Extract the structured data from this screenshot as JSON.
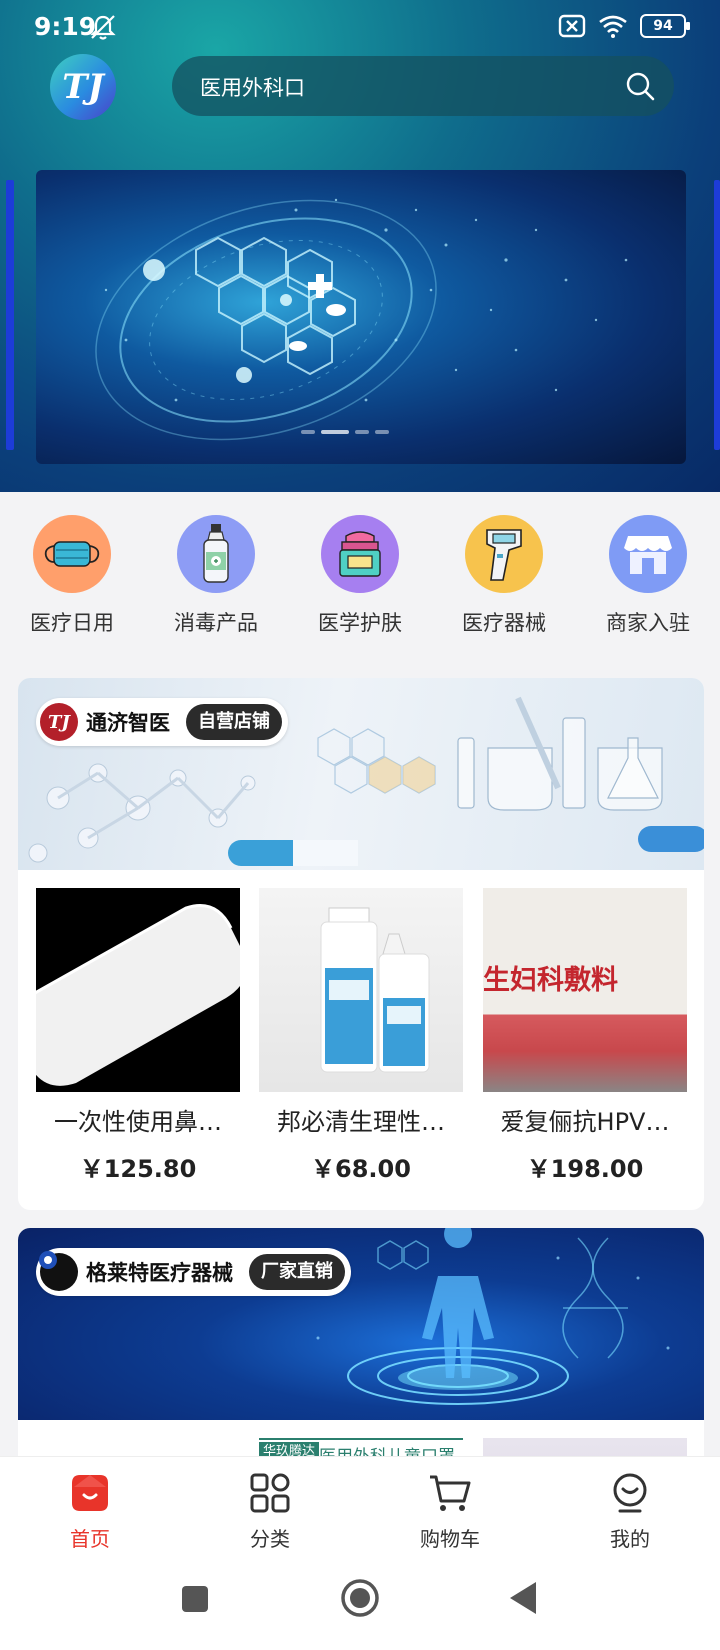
{
  "status_bar": {
    "time": "9:19",
    "battery": "94"
  },
  "search": {
    "value": "医用外科口"
  },
  "categories": [
    {
      "label": "医疗日用",
      "icon": "mask-icon",
      "color": "#ff9f6b"
    },
    {
      "label": "消毒产品",
      "icon": "disinfectant-bottle-icon",
      "color": "#8d9cf5"
    },
    {
      "label": "医学护肤",
      "icon": "skincare-jar-icon",
      "color": "#a67ff0"
    },
    {
      "label": "医疗器械",
      "icon": "thermometer-gun-icon",
      "color": "#f7c34d"
    },
    {
      "label": "商家入驻",
      "icon": "storefront-icon",
      "color": "#7f9bf5"
    }
  ],
  "stores": [
    {
      "name": "通济智医",
      "badge": "自营店铺",
      "logo_text": "TJ",
      "products": [
        {
          "name": "一次性使用鼻…",
          "price": "￥125.80"
        },
        {
          "name": "邦必清生理性…",
          "price": "￥68.00"
        },
        {
          "name": "爱复俪抗HPV…",
          "price": "￥198.00",
          "image_text": "生妇科敷料"
        }
      ]
    },
    {
      "name": "格莱特医疗器械",
      "badge": "厂家直销",
      "products_partial": [
        {
          "image_text_1": "华玖腾达",
          "image_text_2": "医用外科儿童口罩"
        }
      ]
    }
  ],
  "tabs": [
    {
      "label": "首页",
      "icon": "home-icon",
      "active": true
    },
    {
      "label": "分类",
      "icon": "category-grid-icon",
      "active": false
    },
    {
      "label": "购物车",
      "icon": "cart-icon",
      "active": false
    },
    {
      "label": "我的",
      "icon": "profile-icon",
      "active": false
    }
  ],
  "colors": {
    "accent": "#e8342a",
    "badge_bg": "#2b2b2b",
    "hero_teal": "#1aa6a6",
    "hero_blue": "#082a66"
  }
}
